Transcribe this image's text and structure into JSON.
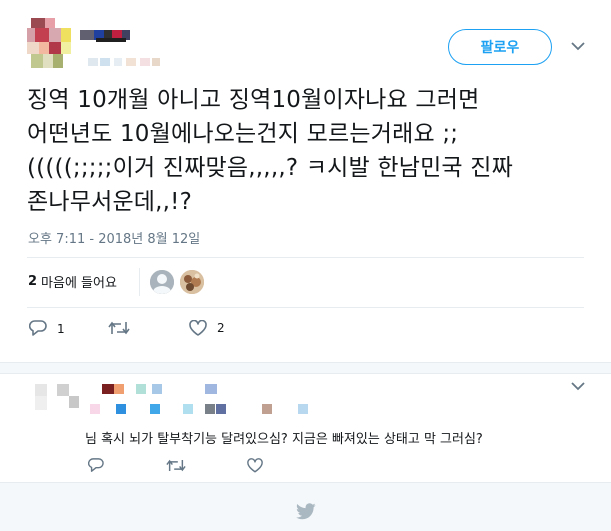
{
  "tweet": {
    "follow_label": "팔로우",
    "text_lines": [
      "징역 10개월 아니고 징역10월이자나요 그러면",
      "어떤년도 10월에나오는건지 모르는거래요 ;;",
      "(((((;;;;;이거 진짜맞음,,,,,? ㅋ시발 한남민국 진짜",
      "존나무서운데,,!?"
    ],
    "timestamp": "오후 7:11 - 2018년 8월 12일",
    "likes": {
      "count": "2",
      "label": "마음에 들어요"
    },
    "actions": {
      "reply_count": "1",
      "like_count": "2"
    }
  },
  "reply": {
    "text": "님 혹시 뇌가 탈부착기능 달려있으심? 지금은 빠져있는 상태고 막 그러심?"
  },
  "colors": {
    "accent": "#1da1f2",
    "muted": "#657786",
    "divider": "#e6ecf0",
    "footer_bg": "#f5f8fa"
  },
  "icons": [
    "chevron-down-icon",
    "reply-icon",
    "retweet-icon",
    "like-icon",
    "twitter-bird-icon"
  ]
}
